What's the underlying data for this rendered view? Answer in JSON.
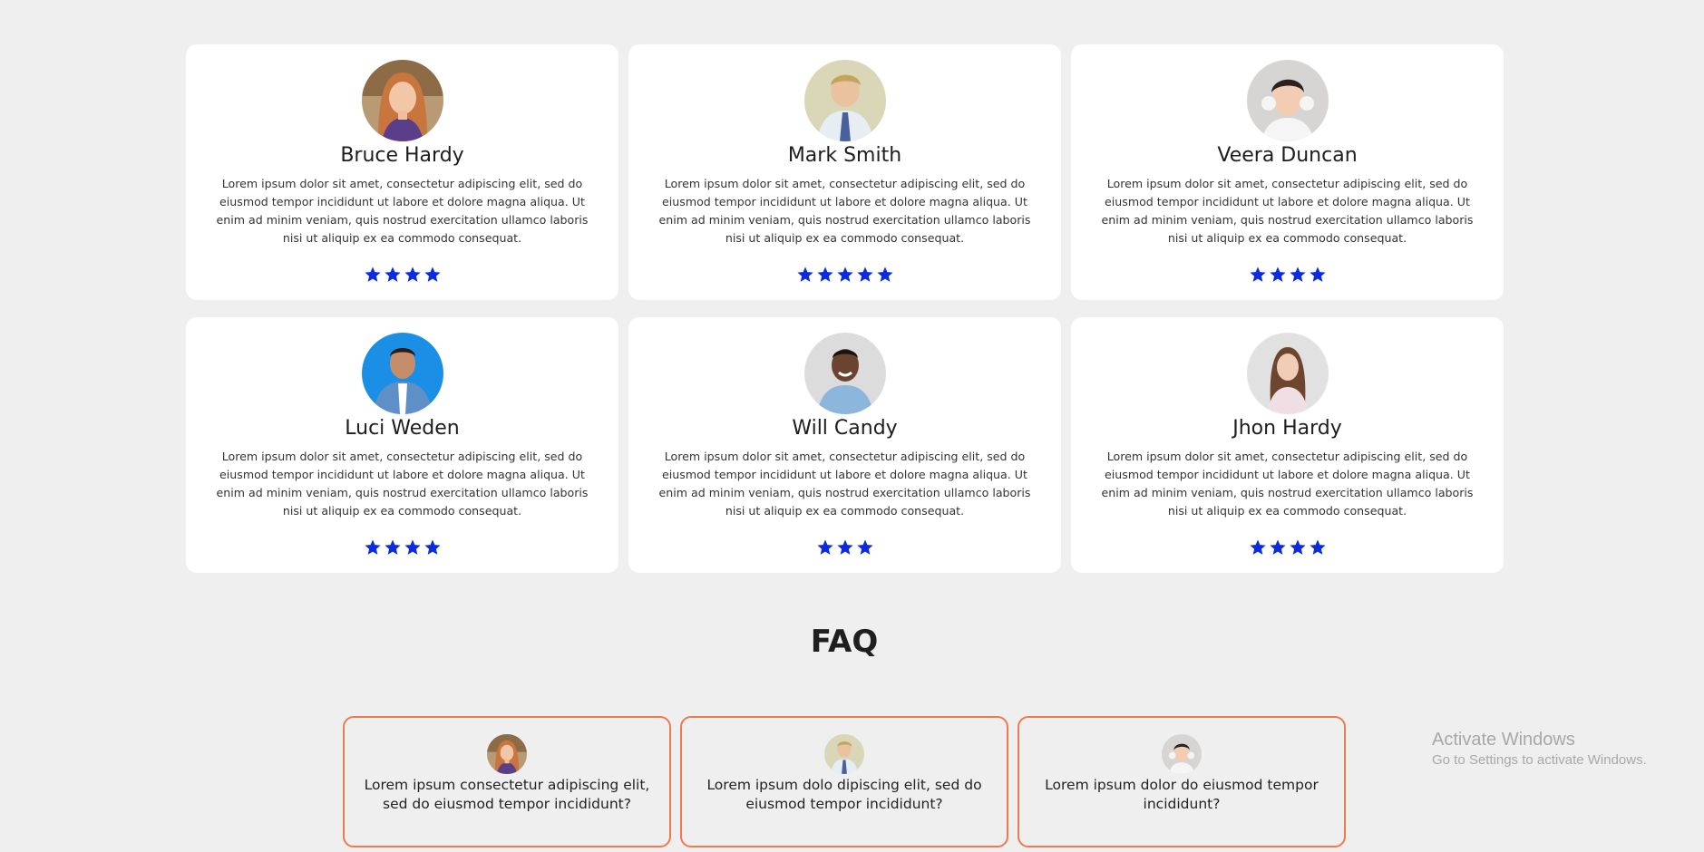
{
  "colors": {
    "star": "#0a2be0",
    "faq_border": "#f07a4c",
    "page_bg": "#efefef",
    "card_bg": "#ffffff"
  },
  "testimonials": [
    {
      "name": "Bruce Hardy",
      "rating": 4,
      "avatar": "woman-red-hair-photo",
      "text": "Lorem ipsum dolor sit amet, consectetur adipiscing elit, sed do eiusmod tempor incididunt ut labore et dolore magna aliqua. Ut enim ad minim veniam, quis nostrud exercitation ullamco laboris nisi ut aliquip ex ea commodo consequat."
    },
    {
      "name": "Mark Smith",
      "rating": 5,
      "avatar": "man-tie-photo",
      "text": "Lorem ipsum dolor sit amet, consectetur adipiscing elit, sed do eiusmod tempor incididunt ut labore et dolore magna aliqua. Ut enim ad minim veniam, quis nostrud exercitation ullamco laboris nisi ut aliquip ex ea commodo consequat."
    },
    {
      "name": "Veera Duncan",
      "rating": 4,
      "avatar": "man-headphones-photo",
      "text": "Lorem ipsum dolor sit amet, consectetur adipiscing elit, sed do eiusmod tempor incididunt ut labore et dolore magna aliqua. Ut enim ad minim veniam, quis nostrud exercitation ullamco laboris nisi ut aliquip ex ea commodo consequat."
    },
    {
      "name": "Luci Weden",
      "rating": 4,
      "avatar": "man-denim-photo",
      "text": "Lorem ipsum dolor sit amet, consectetur adipiscing elit, sed do eiusmod tempor incididunt ut labore et dolore magna aliqua. Ut enim ad minim veniam, quis nostrud exercitation ullamco laboris nisi ut aliquip ex ea commodo consequat."
    },
    {
      "name": "Will Candy",
      "rating": 3,
      "avatar": "man-smiling-photo",
      "text": "Lorem ipsum dolor sit amet, consectetur adipiscing elit, sed do eiusmod tempor incididunt ut labore et dolore magna aliqua. Ut enim ad minim veniam, quis nostrud exercitation ullamco laboris nisi ut aliquip ex ea commodo consequat."
    },
    {
      "name": "Jhon Hardy",
      "rating": 4,
      "avatar": "woman-long-hair-photo",
      "text": "Lorem ipsum dolor sit amet, consectetur adipiscing elit, sed do eiusmod tempor incididunt ut labore et dolore magna aliqua. Ut enim ad minim veniam, quis nostrud exercitation ullamco laboris nisi ut aliquip ex ea commodo consequat."
    }
  ],
  "faq": {
    "title": "FAQ",
    "items": [
      {
        "question": "Lorem ipsum consectetur adipiscing elit, sed do eiusmod tempor incididunt?",
        "avatar": "woman-red-hair-photo"
      },
      {
        "question": "Lorem ipsum dolo dipiscing elit, sed do eiusmod tempor incididunt?",
        "avatar": "man-tie-photo"
      },
      {
        "question": "Lorem ipsum dolor do eiusmod tempor incididunt?",
        "avatar": "man-headphones-photo"
      }
    ]
  },
  "watermark": {
    "title": "Activate Windows",
    "subtitle": "Go to Settings to activate Windows."
  }
}
